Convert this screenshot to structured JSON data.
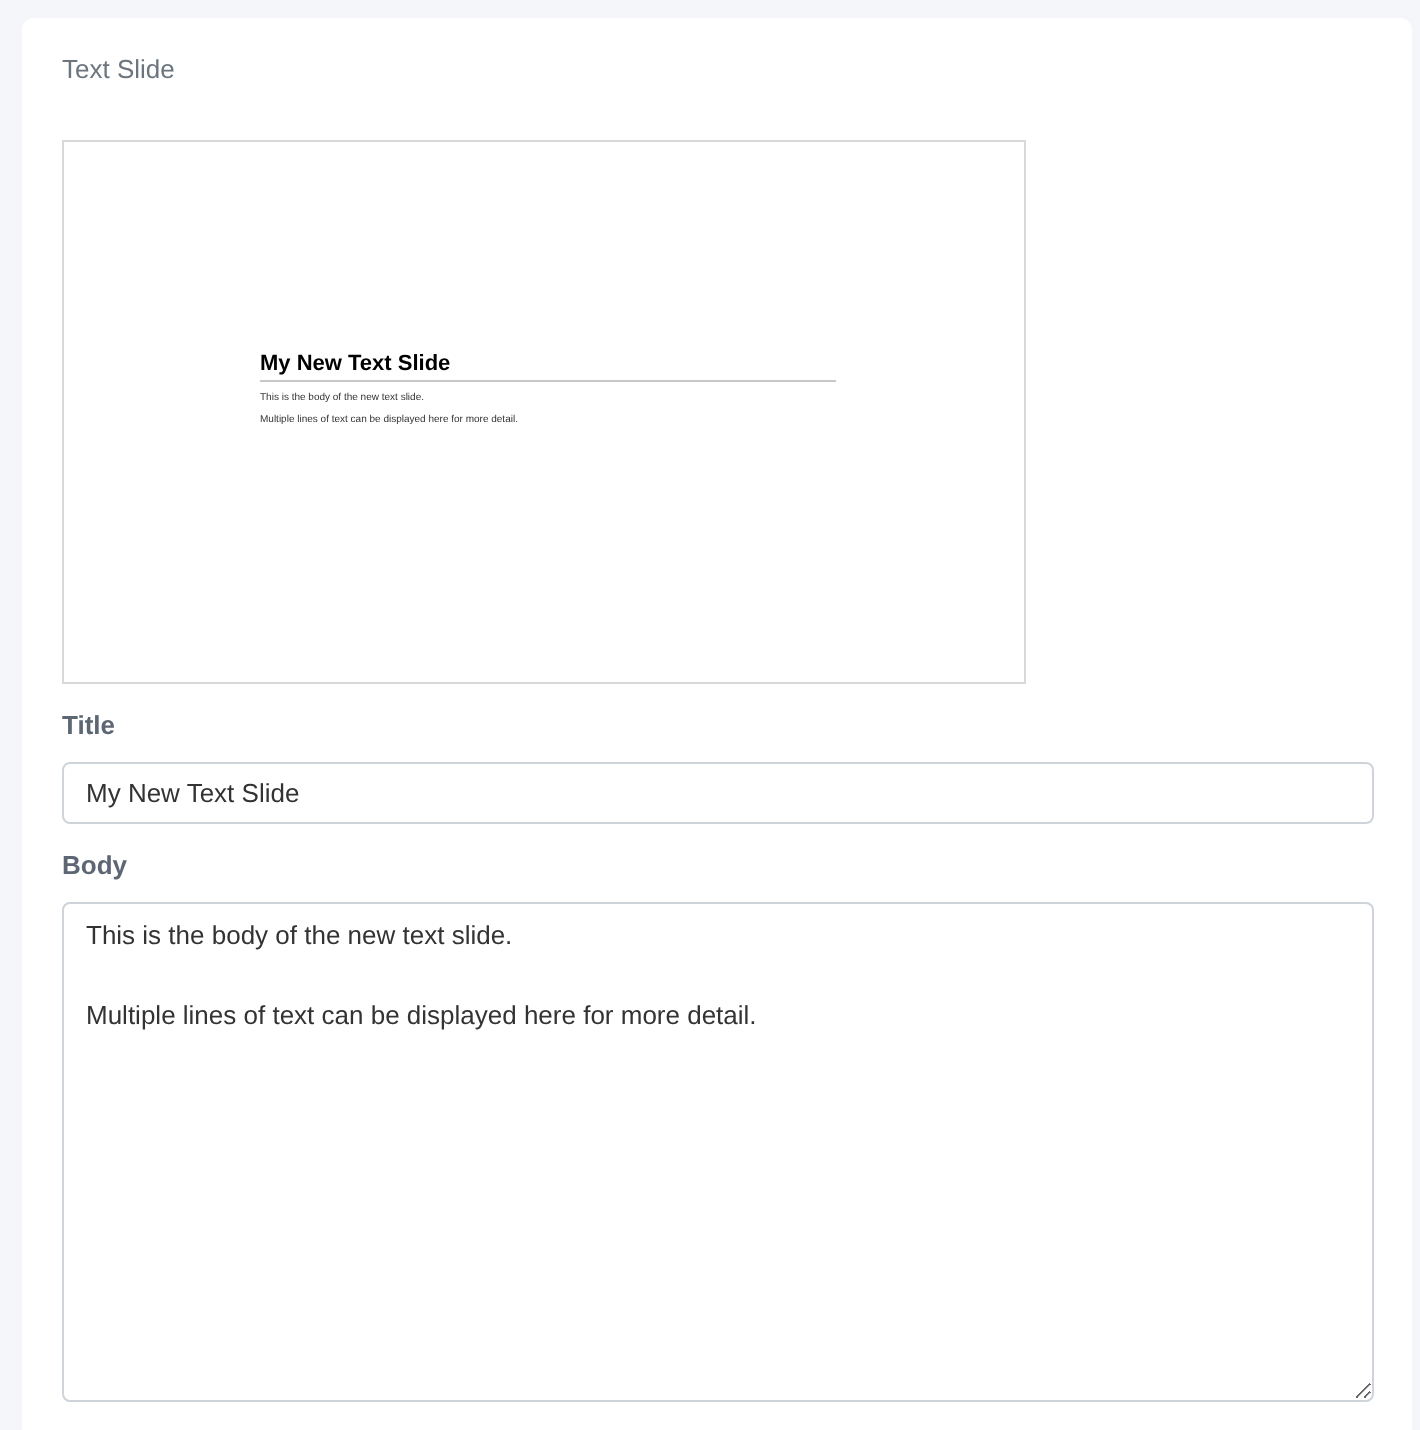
{
  "card": {
    "title": "Text Slide"
  },
  "preview": {
    "title": "My New Text Slide",
    "paragraphs": [
      "This is the body of the new text slide.",
      "Multiple lines of text can be displayed here for more detail."
    ]
  },
  "fields": [
    {
      "kind": "input",
      "label": "Title",
      "value": "My New Text Slide"
    },
    {
      "kind": "textarea",
      "label": "Body",
      "value": "This is the body of the new text slide.\n\nMultiple lines of text can be displayed here for more detail."
    }
  ]
}
